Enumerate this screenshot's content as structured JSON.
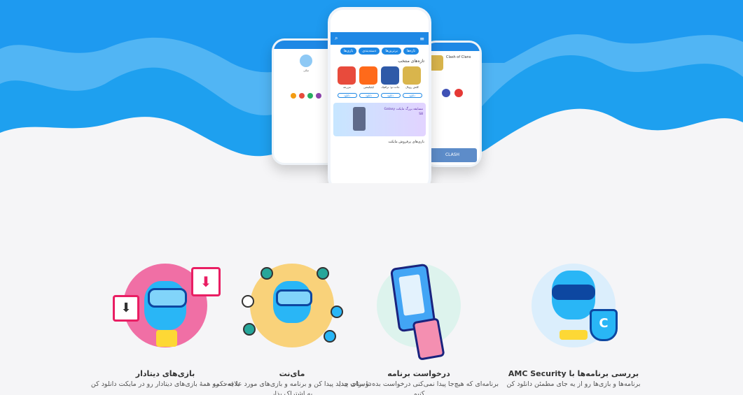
{
  "hero": {
    "main_phone": {
      "tabs": [
        "بازی‌ها",
        "دسته‌بندی",
        "برترین‌ها",
        "تازه‌ها"
      ],
      "section_title": "تازه‌های منتخب",
      "apps": [
        {
          "name": "کلش رویال",
          "button": "دانلود",
          "color": "#d9b54c"
        },
        {
          "name": "جاده دو: ترافیک",
          "button": "دانلود",
          "color": "#2f5aa8"
        },
        {
          "name": "اپلیکیشن",
          "button": "دانلود",
          "color": "#ff6a1a"
        },
        {
          "name": "مزرعه",
          "button": "دانلود",
          "color": "#e84b3c"
        }
      ],
      "banner_text": "مسابقه بزرگ مایکت Galaxy S8",
      "footer_title": "بازی‌های پرفروش مایکت"
    },
    "right_phone": {
      "app_title": "Clash of Clans",
      "tag": "CLASH"
    },
    "left_phone": {
      "user": "نیکی"
    }
  },
  "features": [
    {
      "title": "بازی‌های دیتادار",
      "desc": "با یه دکمه همهٔ بازی‌های دیتادار رو در مایکت دانلود کن",
      "icon": "download-character-icon"
    },
    {
      "title": "مای‌نت",
      "desc": "دوستای جدید پیدا کن و برنامه و بازی‌های مورد علاقه‌ت رو به اشتراک بذار",
      "icon": "network-character-icon"
    },
    {
      "title": "درخواست برنامه",
      "desc": "برنامه‌ای که هیچ‌جا پیدا نمی‌کنی درخواست بده تا برات پیدا کنیم",
      "icon": "phone-request-icon"
    },
    {
      "title": "بررسی برنامه‌ها با AMC Security",
      "desc": "برنامه‌ها و بازی‌ها رو از یه جای مطمئن دانلود کن",
      "icon": "security-shield-character-icon"
    }
  ],
  "colors": {
    "brand": "#1e88e5",
    "wave_light": "#5bb8f5",
    "bg": "#f5f5f7"
  }
}
